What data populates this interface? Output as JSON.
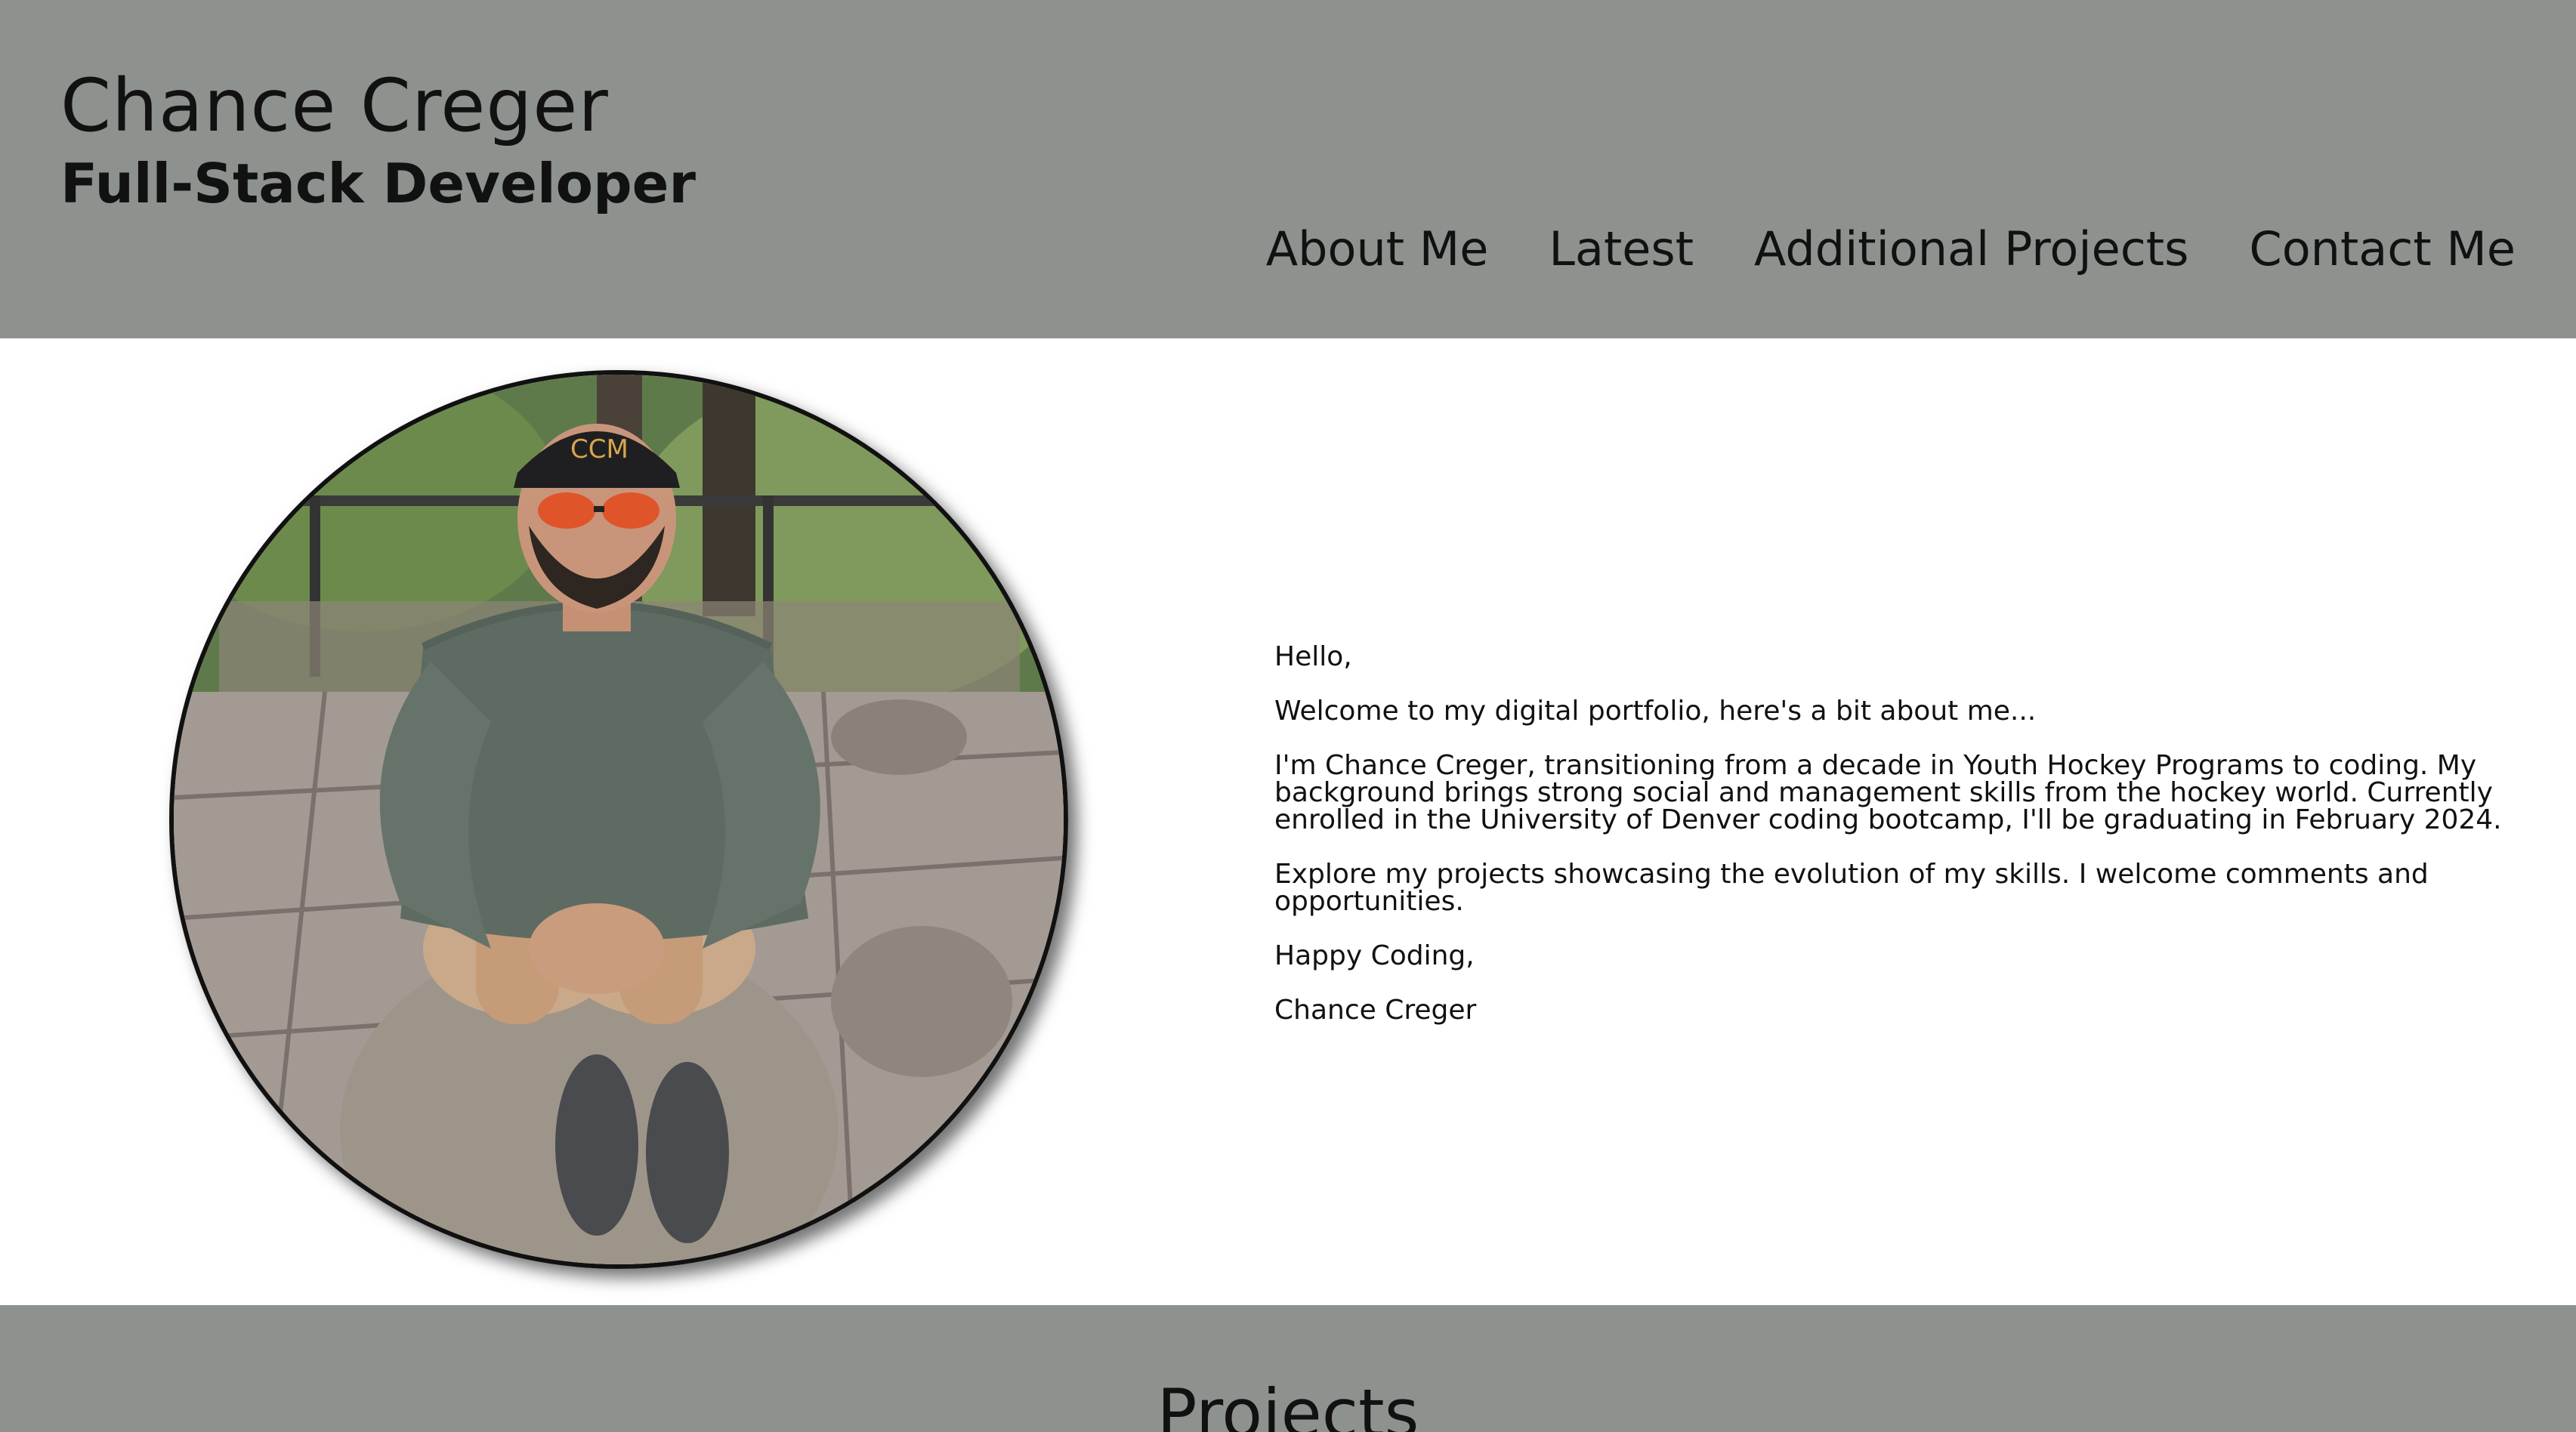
{
  "header": {
    "name": "Chance Creger",
    "tagline": "Full-Stack Developer",
    "nav": [
      "About Me",
      "Latest",
      "Additional Projects",
      "Contact Me"
    ]
  },
  "about": {
    "paragraphs": [
      "Hello,",
      "Welcome to my digital portfolio, here's a bit about me...",
      "I'm Chance Creger, transitioning from a decade in Youth Hockey Programs to coding. My background brings strong social and management skills from the hockey world. Currently enrolled in the University of Denver coding bootcamp, I'll be graduating in February 2024.",
      "Explore my projects showcasing the evolution of my skills. I welcome comments and opportunities.",
      "Happy Coding,",
      "Chance Creger"
    ]
  },
  "projects": {
    "heading": "Projects"
  },
  "colors": {
    "band": "#8d928e",
    "background": "#ffffff",
    "text": "#111111"
  }
}
